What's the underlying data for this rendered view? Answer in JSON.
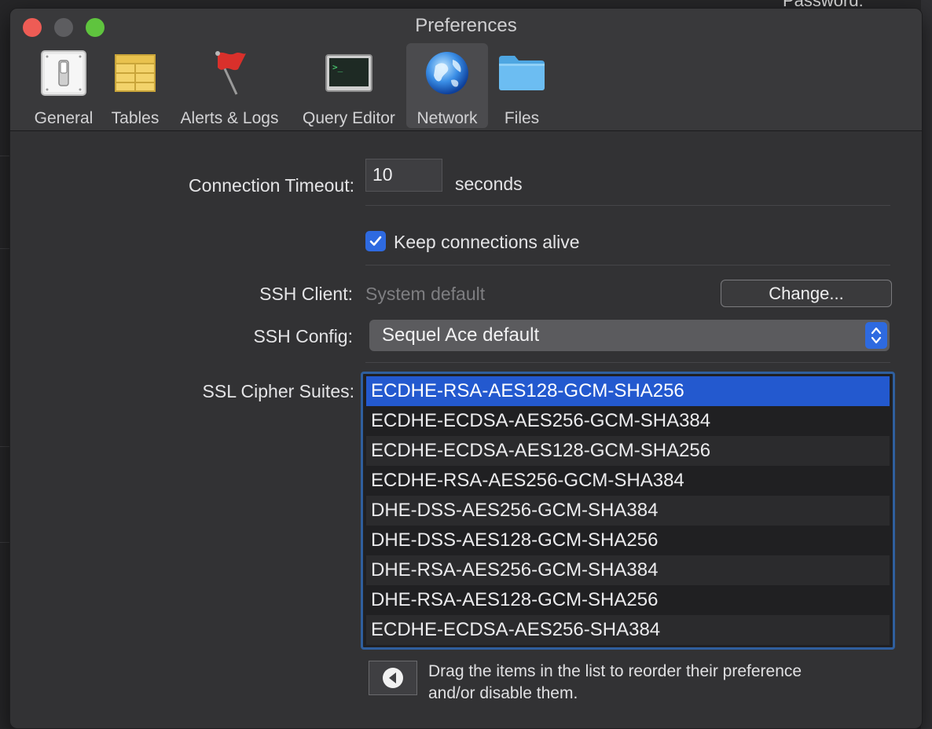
{
  "window": {
    "title": "Preferences"
  },
  "toolbar": {
    "items": [
      {
        "label": "General",
        "icon": "switch-icon"
      },
      {
        "label": "Tables",
        "icon": "table-grid-icon"
      },
      {
        "label": "Alerts & Logs",
        "icon": "red-flag-icon"
      },
      {
        "label": "Query Editor",
        "icon": "terminal-icon"
      },
      {
        "label": "Network",
        "icon": "globe-icon",
        "selected": true
      },
      {
        "label": "Files",
        "icon": "folder-icon"
      }
    ]
  },
  "network": {
    "connection_timeout_label": "Connection Timeout:",
    "connection_timeout_value": "10",
    "seconds_label": "seconds",
    "keep_alive_label": "Keep connections alive",
    "keep_alive_checked": true,
    "ssh_client_label": "SSH Client:",
    "ssh_client_value": "System default",
    "change_button_label": "Change...",
    "ssh_config_label": "SSH Config:",
    "ssh_config_value": "Sequel Ace default",
    "ssl_cipher_label": "SSL Cipher Suites:",
    "cipher_suites": [
      "ECDHE-RSA-AES128-GCM-SHA256",
      "ECDHE-ECDSA-AES256-GCM-SHA384",
      "ECDHE-ECDSA-AES128-GCM-SHA256",
      "ECDHE-RSA-AES256-GCM-SHA384",
      "DHE-DSS-AES256-GCM-SHA384",
      "DHE-DSS-AES128-GCM-SHA256",
      "DHE-RSA-AES256-GCM-SHA384",
      "DHE-RSA-AES128-GCM-SHA256",
      "ECDHE-ECDSA-AES256-SHA384"
    ],
    "selected_cipher_index": 0,
    "hint_line1": "Drag the items in the list to reorder their preference",
    "hint_line2": "and/or disable them."
  },
  "background": {
    "password_label": "Password:"
  },
  "colors": {
    "accent": "#2e6ae0",
    "selection": "#2359cf",
    "close": "#ee5c55",
    "maximize": "#5fc43e"
  }
}
